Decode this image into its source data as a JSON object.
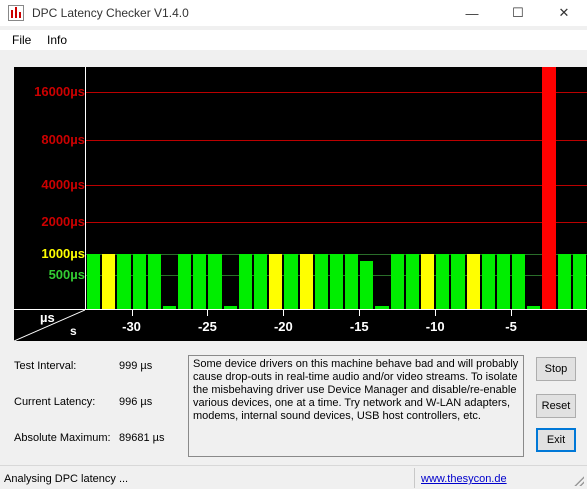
{
  "window": {
    "title": "DPC Latency Checker V1.4.0",
    "minimize_glyph": "—",
    "maximize_glyph": "☐",
    "close_glyph": "✕"
  },
  "menu": {
    "file": "File",
    "info": "Info"
  },
  "chart_data": {
    "type": "bar",
    "y_ticks": [
      {
        "label": "16000µs",
        "value": 16000,
        "color": "#cc0000"
      },
      {
        "label": "8000µs",
        "value": 8000,
        "color": "#cc0000"
      },
      {
        "label": "4000µs",
        "value": 4000,
        "color": "#cc0000"
      },
      {
        "label": "2000µs",
        "value": 2000,
        "color": "#cc0000"
      },
      {
        "label": "1000µs",
        "value": 1000,
        "color": "#ffff00"
      },
      {
        "label": "500µs",
        "value": 500,
        "color": "#33cc33"
      }
    ],
    "x_ticks": [
      "-30",
      "-25",
      "-20",
      "-15",
      "-10",
      "-5"
    ],
    "x_tick_values": [
      -30,
      -25,
      -20,
      -15,
      -10,
      -5
    ],
    "x_range": [
      -33,
      0
    ],
    "y_unit": "µs",
    "x_unit": "s",
    "scale": "log",
    "grid": true,
    "values": [
      1000,
      1000,
      1000,
      1000,
      1000,
      100,
      1000,
      1000,
      1000,
      100,
      1000,
      1000,
      1000,
      1000,
      1000,
      1000,
      1000,
      1000,
      800,
      100,
      1000,
      1000,
      1000,
      1000,
      1000,
      1000,
      1000,
      1000,
      1000,
      100,
      89681,
      1000,
      1000
    ],
    "colors": [
      "green",
      "yellow",
      "green",
      "green",
      "green",
      "green",
      "green",
      "green",
      "green",
      "green",
      "green",
      "green",
      "yellow",
      "green",
      "yellow",
      "green",
      "green",
      "green",
      "green",
      "green",
      "green",
      "green",
      "yellow",
      "green",
      "green",
      "yellow",
      "green",
      "green",
      "green",
      "green",
      "red",
      "green",
      "green"
    ],
    "palette": {
      "green": "#00ee00",
      "yellow": "#ffff00",
      "red": "#ff0000"
    }
  },
  "info": {
    "test_interval_label": "Test Interval:",
    "test_interval_value": "999 µs",
    "current_latency_label": "Current Latency:",
    "current_latency_value": "996 µs",
    "absolute_maximum_label": "Absolute Maximum:",
    "absolute_maximum_value": "89681 µs"
  },
  "message": "Some device drivers on this machine behave bad and will probably cause drop-outs in real-time audio and/or video streams. To isolate the misbehaving driver use Device Manager and disable/re-enable various devices, one at a time. Try network and W-LAN adapters, modems, internal sound devices, USB host controllers, etc.",
  "buttons": {
    "stop": "Stop",
    "reset": "Reset",
    "exit": "Exit"
  },
  "status": {
    "text": "Analysing DPC latency ...",
    "link": "www.thesycon.de"
  }
}
